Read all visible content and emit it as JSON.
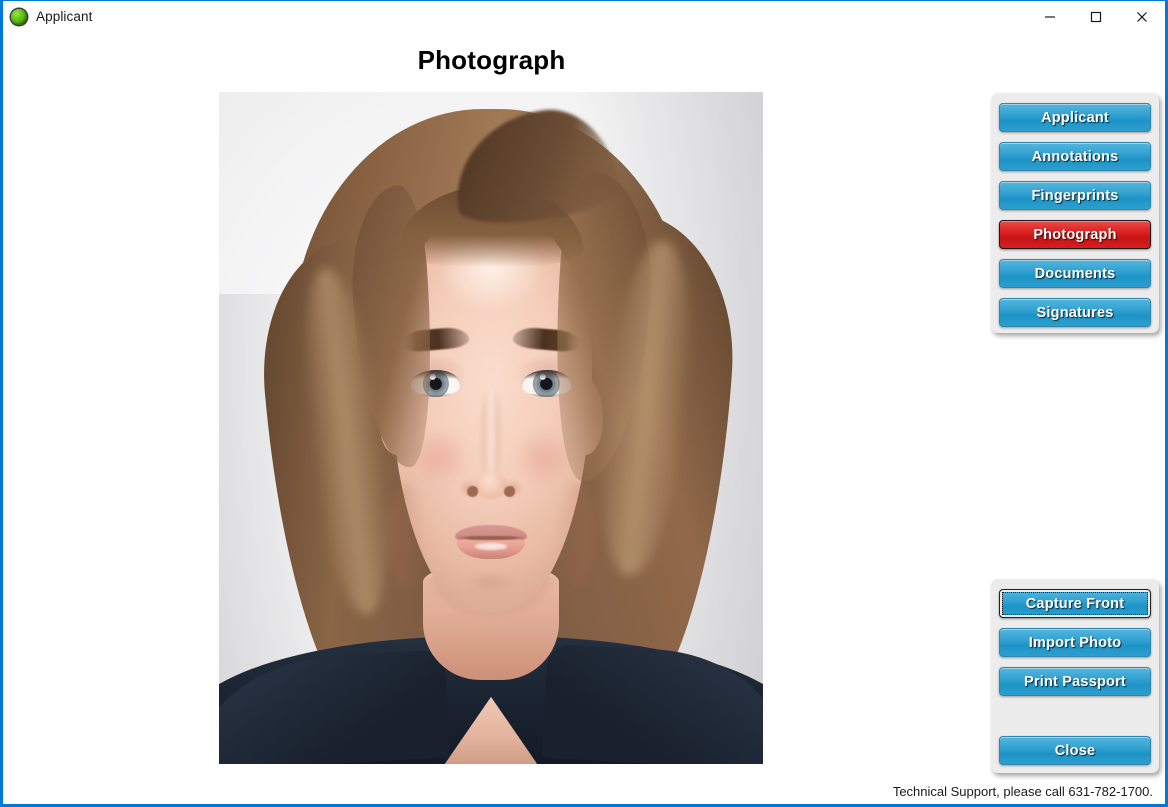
{
  "window": {
    "title": "Applicant",
    "icon": "green-orb-icon",
    "controls": [
      {
        "name": "minimize",
        "glyph": "minimize-icon"
      },
      {
        "name": "maximize",
        "glyph": "maximize-icon"
      },
      {
        "name": "close",
        "glyph": "close-icon"
      }
    ]
  },
  "page": {
    "title": "Photograph"
  },
  "photo": {
    "alt": "applicant-passport-photograph",
    "subject": "woman facing camera, shoulder-length light brown hair, dark suit jacket, light gray background"
  },
  "nav": {
    "items": [
      {
        "label": "Applicant",
        "active": false
      },
      {
        "label": "Annotations",
        "active": false
      },
      {
        "label": "Fingerprints",
        "active": false
      },
      {
        "label": "Photograph",
        "active": true
      },
      {
        "label": "Documents",
        "active": false
      },
      {
        "label": "Signatures",
        "active": false
      }
    ]
  },
  "actions": {
    "items": [
      {
        "label": "Capture Front",
        "focused": true
      },
      {
        "label": "Import Photo",
        "focused": false
      },
      {
        "label": "Print Passport",
        "focused": false
      }
    ],
    "close": {
      "label": "Close"
    }
  },
  "footer": {
    "support_text": "Technical Support, please call 631-782-1700."
  },
  "colors": {
    "window_border": "#0078d7",
    "button_blue": "#2c9fd0",
    "button_active_red": "#d62020",
    "panel_bg": "#ececec",
    "title_text": "#000000"
  }
}
